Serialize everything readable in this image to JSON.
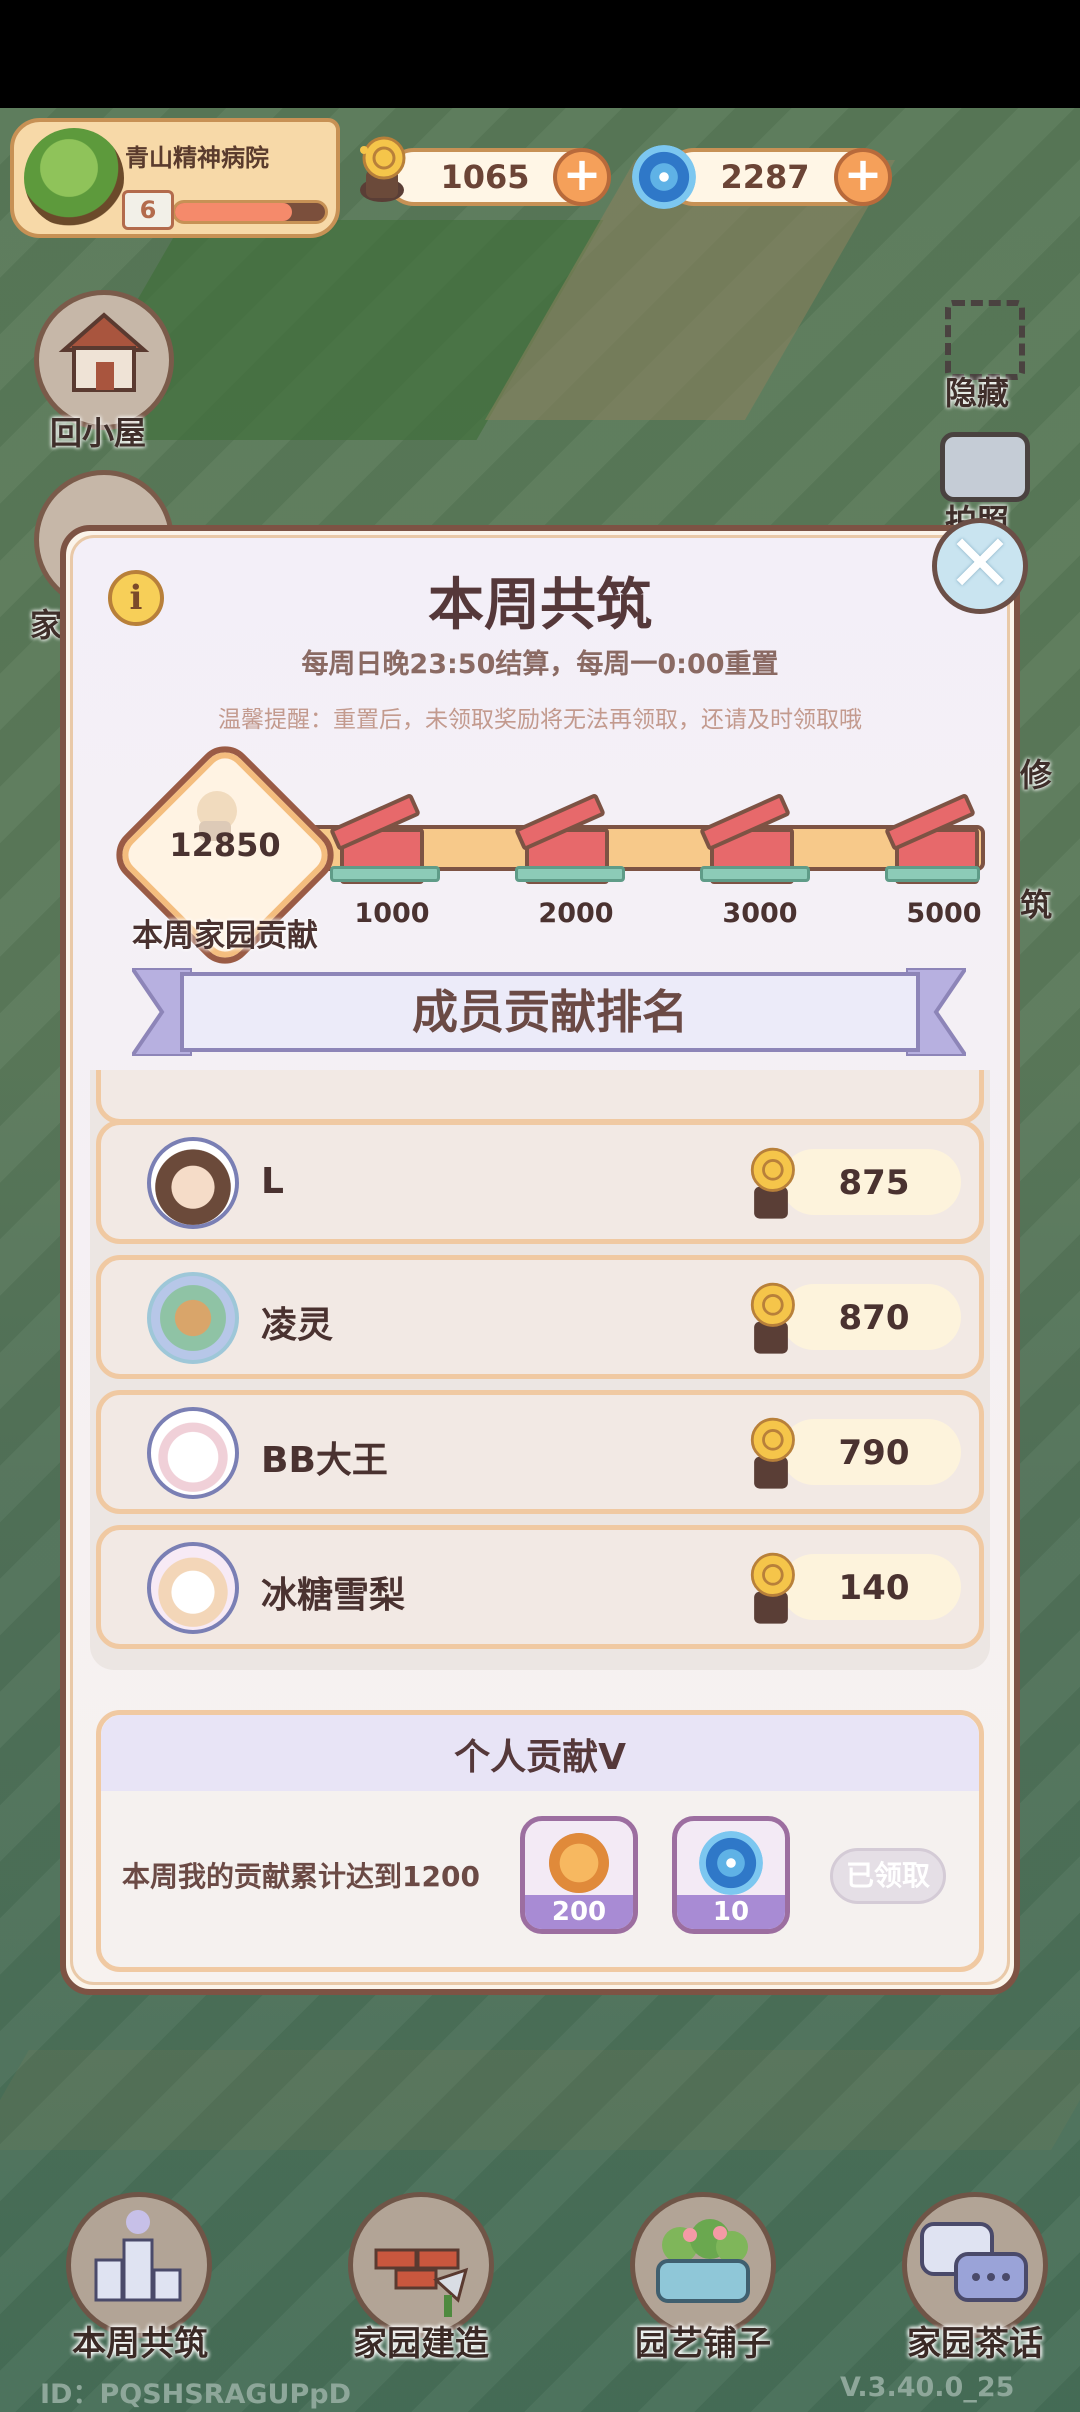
{
  "topbar": {
    "venue_name": "青山精神病院",
    "level": "6",
    "level_progress": 0.78,
    "snail_currency": "1065",
    "swirl_currency": "2287"
  },
  "side_buttons": {
    "home": "回小屋",
    "home_partial": "家",
    "hide": "隐藏",
    "photo_partial": "拍照",
    "right_partial_1": "修",
    "right_partial_2": "筑"
  },
  "dialog": {
    "title": "本周共筑",
    "subtitle": "每周日晚23:50结算，每周一0:00重置",
    "tip": "温馨提醒：重置后，未领取奖励将无法再领取，还请及时领取哦",
    "info_icon": "i",
    "close_icon": "✕",
    "score": "12850",
    "score_label": "本周家园贡献",
    "milestones": [
      "1000",
      "2000",
      "3000",
      "5000"
    ],
    "ranking_title": "成员贡献排名",
    "rows": [
      {
        "name": "L",
        "score": "875",
        "avatar": "girl-avatar"
      },
      {
        "name": "凌灵",
        "score": "870",
        "avatar": "flower-dog-avatar"
      },
      {
        "name": "BB大王",
        "score": "790",
        "avatar": "sheep-avatar"
      },
      {
        "name": "冰糖雪梨",
        "score": "140",
        "avatar": "unicorn-avatar"
      }
    ],
    "personal": {
      "title": "个人贡献Ⅴ",
      "goal": "本周我的贡献累计达到1200",
      "rewards": [
        {
          "amount": "200",
          "icon": "coin-icon"
        },
        {
          "amount": "10",
          "icon": "swirl-icon"
        }
      ],
      "claimed_label": "已领取"
    }
  },
  "nav": {
    "items": [
      {
        "label": "本周共筑",
        "icon": "podium-icon"
      },
      {
        "label": "家园建造",
        "icon": "brick-trowel-icon"
      },
      {
        "label": "园艺铺子",
        "icon": "flower-basket-icon"
      },
      {
        "label": "家园茶话",
        "icon": "chat-bubbles-icon"
      }
    ]
  },
  "footer": {
    "id": "ID：PQSHSRAGUPpD",
    "version": "V.3.40.0_25"
  },
  "colors": {
    "accent_red": "#e7696b",
    "panel_border": "#7d5344",
    "banner_purple": "#8d85b8"
  }
}
